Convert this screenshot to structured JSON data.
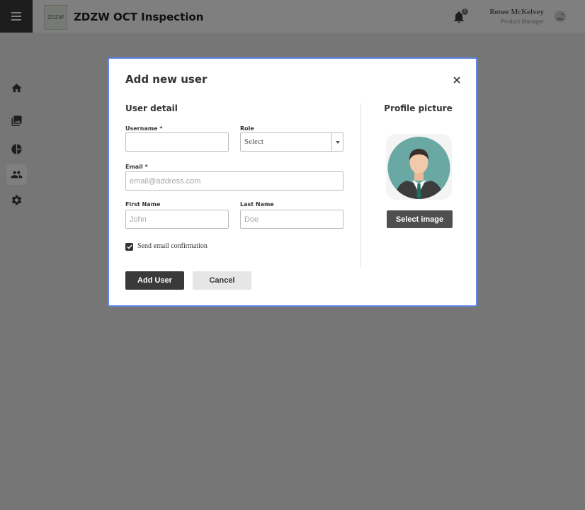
{
  "app": {
    "title": "ZDZW OCT Inspection",
    "logo_text": "ZDZW"
  },
  "header": {
    "user_name": "Renee McKelvey",
    "user_role": "Product Manager",
    "notification_count": "1",
    "bell_icon": "bell-icon",
    "avatar_icon": "user-avatar-icon"
  },
  "sidebar": {
    "menu_icon": "hamburger-menu-icon",
    "items": [
      {
        "name": "home",
        "icon": "home-icon",
        "active": false
      },
      {
        "name": "gallery",
        "icon": "image-gallery-icon",
        "active": false
      },
      {
        "name": "statistics",
        "icon": "pie-chart-icon",
        "active": false
      },
      {
        "name": "users",
        "icon": "users-icon",
        "active": true
      },
      {
        "name": "settings",
        "icon": "gear-icon",
        "active": false
      }
    ]
  },
  "modal": {
    "title": "Add new user",
    "close_icon": "close-icon",
    "user_detail_title": "User detail",
    "username": {
      "label": "Username *",
      "value": "",
      "placeholder": ""
    },
    "role": {
      "label": "Role",
      "value": "Select"
    },
    "email": {
      "label": "Email *",
      "value": "",
      "placeholder": "email@address.com"
    },
    "first_name": {
      "label": "First Name",
      "value": "",
      "placeholder": "John"
    },
    "last_name": {
      "label": "Last Name",
      "value": "",
      "placeholder": "Doe"
    },
    "send_email": {
      "label": "Send email confirmation",
      "checked": true
    },
    "profile_title": "Profile picture",
    "select_image_label": "Select image",
    "add_user_label": "Add User",
    "cancel_label": "Cancel"
  },
  "colors": {
    "accent_border": "#5f86e8",
    "primary_button": "#3a3a3a",
    "overlay": "rgba(0,0,0,0.5)",
    "avatar_bg": "#6aa9a3"
  }
}
